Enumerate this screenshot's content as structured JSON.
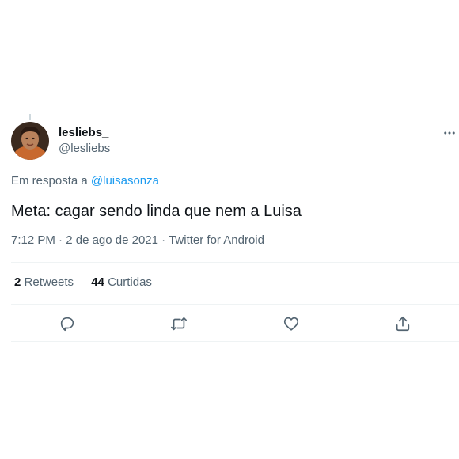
{
  "tweet": {
    "author": {
      "display_name": "lesliebs_",
      "handle": "@lesliebs_"
    },
    "reply_prefix": "Em resposta a",
    "reply_to": "@luisasonza",
    "text": "Meta: cagar sendo linda que nem a Luisa",
    "time": "7:12 PM",
    "separator": "·",
    "date": "2 de ago de 2021",
    "source": "Twitter for Android",
    "stats": {
      "retweets_count": "2",
      "retweets_label": "Retweets",
      "likes_count": "44",
      "likes_label": "Curtidas"
    }
  },
  "colors": {
    "text_primary": "#0f1419",
    "text_secondary": "#536471",
    "accent": "#1d9bf0",
    "divider": "#eff3f4"
  },
  "icons": [
    "more-icon",
    "reply-icon",
    "retweet-icon",
    "like-icon",
    "share-icon"
  ]
}
